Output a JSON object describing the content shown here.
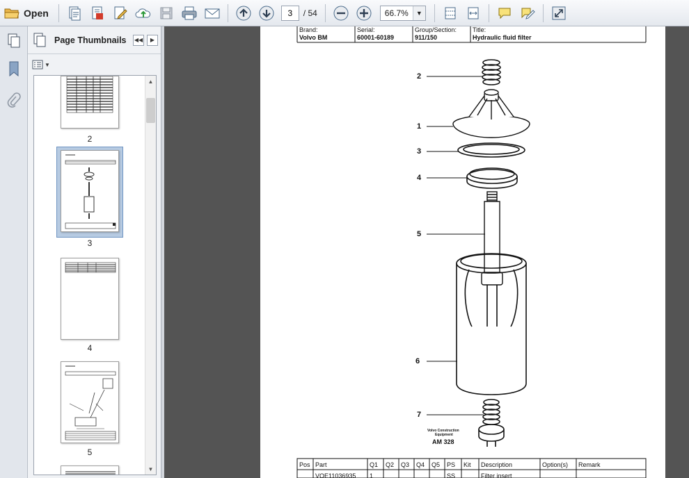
{
  "toolbar": {
    "open_label": "Open",
    "current_page": "3",
    "total_pages": "/ 54",
    "zoom": "66.7%"
  },
  "panel": {
    "title": "Page Thumbnails",
    "thumbnails": [
      {
        "label": "2"
      },
      {
        "label": "3"
      },
      {
        "label": "4"
      },
      {
        "label": "5"
      }
    ]
  },
  "document": {
    "header": {
      "brand_label": "Brand:",
      "brand_value": "Volvo BM",
      "serial_label": "Serial:",
      "serial_value": "60001-60189",
      "group_label": "Group/Section:",
      "group_value": "911/150",
      "title_label": "Title:",
      "title_value": "Hydraulic fluid filter"
    },
    "callouts": [
      "2",
      "1",
      "3",
      "4",
      "5",
      "6",
      "7"
    ],
    "maker_line1": "Volvo Construction",
    "maker_line2": "Equipment",
    "figure_code": "AM 328",
    "parts_table": {
      "columns": [
        "Pos",
        "Part",
        "Q1",
        "Q2",
        "Q3",
        "Q4",
        "Q5",
        "PS",
        "Kit",
        "Description",
        "Option(s)",
        "Remark"
      ],
      "first_row": {
        "part": "VOE11036935",
        "q1": "1",
        "ps": "SS",
        "description": "Filter insert"
      }
    }
  }
}
